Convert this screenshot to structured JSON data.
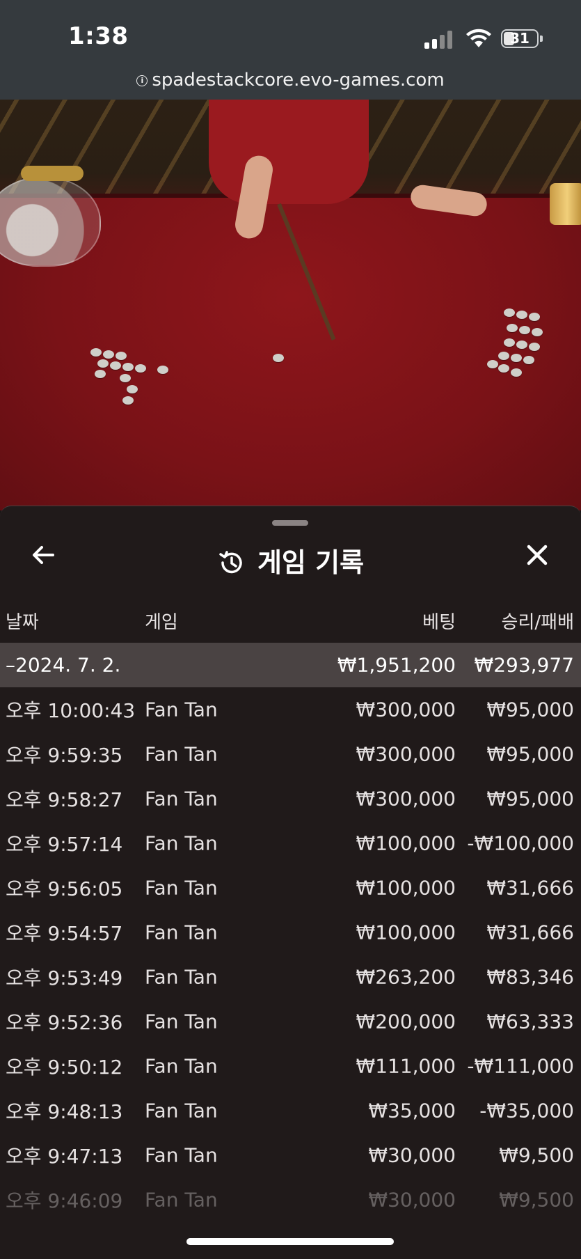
{
  "status_bar": {
    "time": "1:38",
    "battery": "31",
    "url": "spadestackcore.evo-games.com"
  },
  "sheet": {
    "title": "게임 기록",
    "columns": {
      "date": "날짜",
      "game": "게임",
      "bet": "베팅",
      "result": "승리/패배"
    },
    "total": {
      "date": "–2024. 7. 2.",
      "bet": "₩1,951,200",
      "result": "₩293,977"
    },
    "rows": [
      {
        "time": "오후 10:00:43",
        "game": "Fan Tan",
        "bet": "₩300,000",
        "result": "₩95,000"
      },
      {
        "time": "오후 9:59:35",
        "game": "Fan Tan",
        "bet": "₩300,000",
        "result": "₩95,000"
      },
      {
        "time": "오후 9:58:27",
        "game": "Fan Tan",
        "bet": "₩300,000",
        "result": "₩95,000"
      },
      {
        "time": "오후 9:57:14",
        "game": "Fan Tan",
        "bet": "₩100,000",
        "result": "-₩100,000"
      },
      {
        "time": "오후 9:56:05",
        "game": "Fan Tan",
        "bet": "₩100,000",
        "result": "₩31,666"
      },
      {
        "time": "오후 9:54:57",
        "game": "Fan Tan",
        "bet": "₩100,000",
        "result": "₩31,666"
      },
      {
        "time": "오후 9:53:49",
        "game": "Fan Tan",
        "bet": "₩263,200",
        "result": "₩83,346"
      },
      {
        "time": "오후 9:52:36",
        "game": "Fan Tan",
        "bet": "₩200,000",
        "result": "₩63,333"
      },
      {
        "time": "오후 9:50:12",
        "game": "Fan Tan",
        "bet": "₩111,000",
        "result": "-₩111,000"
      },
      {
        "time": "오후 9:48:13",
        "game": "Fan Tan",
        "bet": "₩35,000",
        "result": "-₩35,000"
      },
      {
        "time": "오후 9:47:13",
        "game": "Fan Tan",
        "bet": "₩30,000",
        "result": "₩9,500"
      },
      {
        "time": "오후 9:46:09",
        "game": "Fan Tan",
        "bet": "₩30,000",
        "result": "₩9,500"
      }
    ]
  },
  "icons": {
    "back": "arrow-left-icon",
    "history": "history-icon",
    "close": "close-icon",
    "site_info": "info-icon"
  },
  "colors": {
    "status_bg": "#353a3e",
    "sheet_bg": "#201a1a",
    "total_row_bg": "#4a4343",
    "felt": "#8a1418"
  }
}
